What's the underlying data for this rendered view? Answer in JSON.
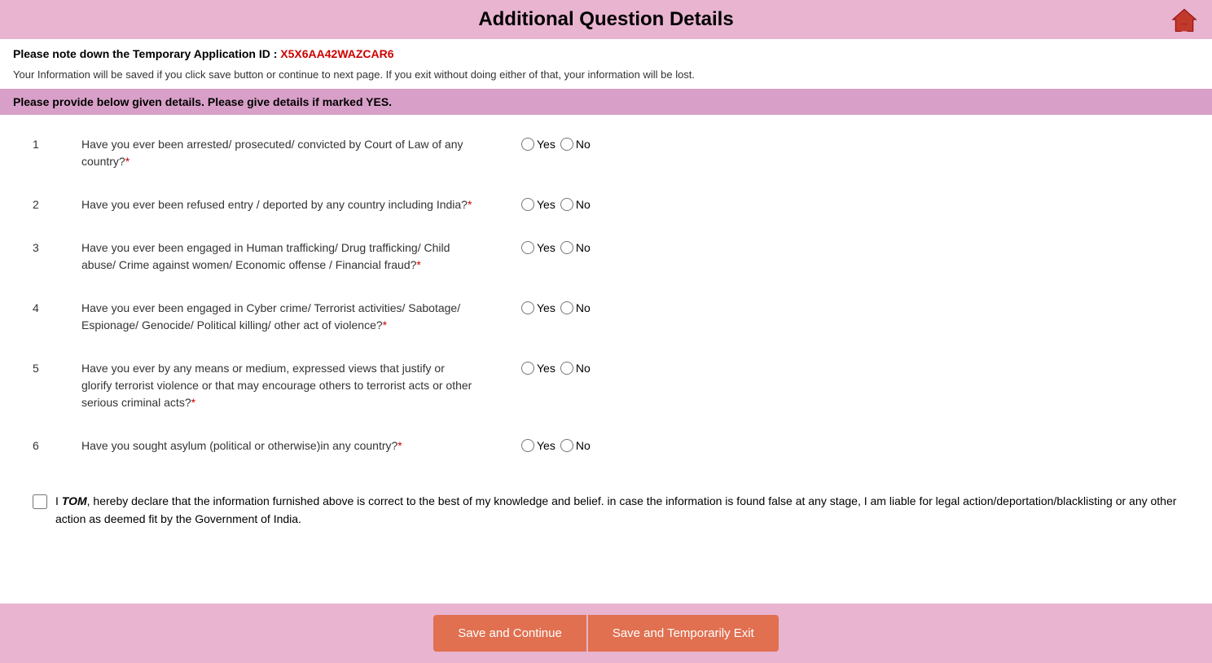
{
  "header": {
    "title": "Additional Question Details"
  },
  "app_id": {
    "label": "Please note down the Temporary Application ID :",
    "value": "X5X6AA42WAZCAR6"
  },
  "info_text": "Your Information will be saved if you click save button or continue to next page. If you exit without doing either of that, your information will be lost.",
  "instruction": "Please provide below given details. Please give details if marked YES.",
  "questions": [
    {
      "number": "1",
      "text": "Have you ever been arrested/ prosecuted/ convicted by Court of Law of any country?",
      "required": true
    },
    {
      "number": "2",
      "text": "Have you ever been refused entry / deported by any country including India?",
      "required": true
    },
    {
      "number": "3",
      "text": "Have you ever been engaged in Human trafficking/ Drug trafficking/ Child abuse/ Crime against women/ Economic offense / Financial fraud?",
      "required": true
    },
    {
      "number": "4",
      "text": "Have you ever been engaged in Cyber crime/ Terrorist activities/ Sabotage/ Espionage/ Genocide/ Political killing/ other act of violence?",
      "required": true
    },
    {
      "number": "5",
      "text": "Have you ever by any means or medium, expressed views that justify or glorify terrorist violence or that may encourage others to terrorist acts or other serious criminal acts?",
      "required": true
    },
    {
      "number": "6",
      "text": "Have you sought asylum (political or otherwise)in any country?",
      "required": true
    }
  ],
  "radio_labels": {
    "yes": "Yes",
    "no": "No"
  },
  "declaration": {
    "name": "TOM",
    "text_before": "I ",
    "text_after": ", hereby declare that the information furnished above is correct to the best of my knowledge and belief. in case the information is found false at any stage, I am liable for legal action/deportation/blacklisting or any other action as deemed fit by the Government of India."
  },
  "buttons": {
    "save_continue": "Save and Continue",
    "save_exit": "Save and Temporarily Exit"
  }
}
